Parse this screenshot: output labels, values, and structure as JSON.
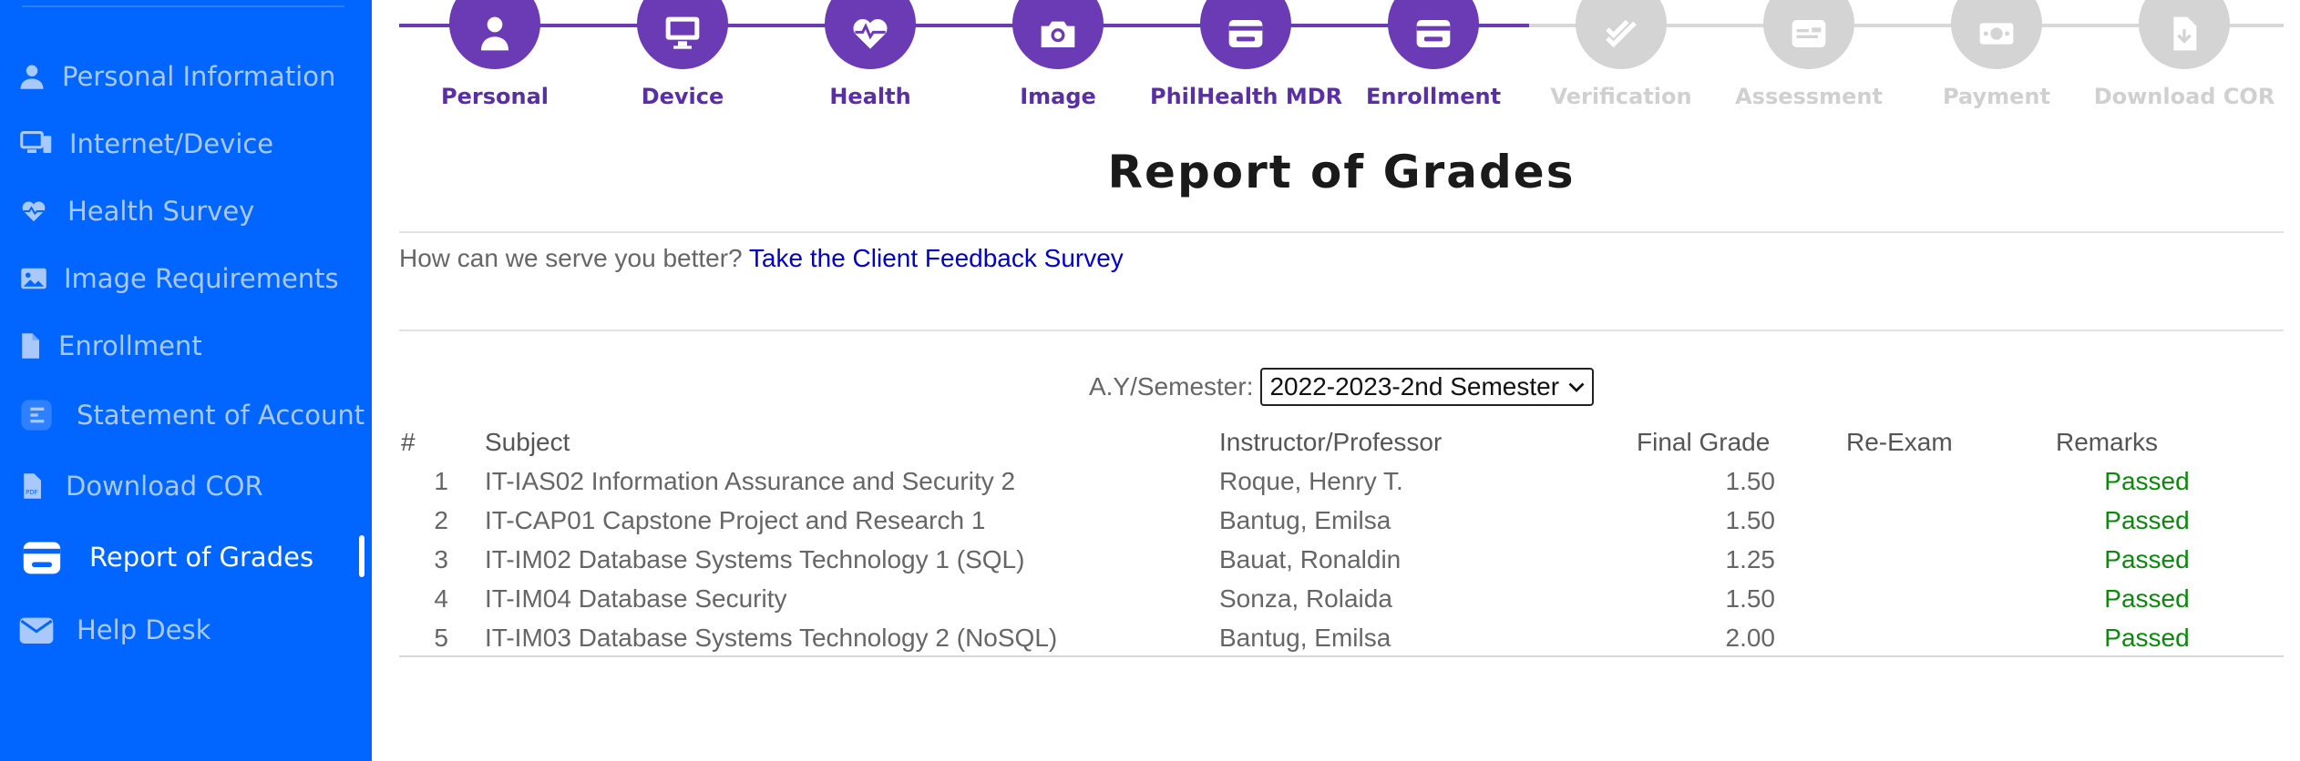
{
  "sidebar": {
    "items": [
      {
        "label": "Personal Information",
        "icon": "person-icon"
      },
      {
        "label": "Internet/Device",
        "icon": "device-icon"
      },
      {
        "label": "Health Survey",
        "icon": "heart-icon"
      },
      {
        "label": "Image Requirements",
        "icon": "image-icon"
      },
      {
        "label": "Enrollment",
        "icon": "file-icon"
      },
      {
        "label": "Statement of Account",
        "icon": "list-icon"
      },
      {
        "label": "Download COR",
        "icon": "pdf-icon"
      },
      {
        "label": "Report of Grades",
        "icon": "wallet-icon"
      },
      {
        "label": "Help Desk",
        "icon": "envelope-icon"
      }
    ],
    "active_item": "Report of Grades"
  },
  "stepper": {
    "steps": [
      {
        "label": "Personal",
        "icon": "person-icon",
        "done": true
      },
      {
        "label": "Device",
        "icon": "monitor-icon",
        "done": true
      },
      {
        "label": "Health",
        "icon": "heartbeat-icon",
        "done": true
      },
      {
        "label": "Image",
        "icon": "camera-icon",
        "done": true
      },
      {
        "label": "PhilHealth MDR",
        "icon": "card-icon",
        "done": true
      },
      {
        "label": "Enrollment",
        "icon": "card-icon",
        "done": true
      },
      {
        "label": "Verification",
        "icon": "check-double-icon",
        "done": false
      },
      {
        "label": "Assessment",
        "icon": "id-card-icon",
        "done": false
      },
      {
        "label": "Payment",
        "icon": "money-icon",
        "done": false
      },
      {
        "label": "Download COR",
        "icon": "file-download-icon",
        "done": false
      }
    ],
    "colors": {
      "done": "#6a3bb5",
      "pending": "#d4d4d4",
      "done_label": "#5a2ea6",
      "pending_label": "#d0d0d0"
    }
  },
  "page": {
    "title": "Report of Grades",
    "survey_prompt": "How can we serve you better?",
    "survey_link": "Take the Client Feedback Survey",
    "semester_label": "A.Y/Semester:",
    "semester_value": "2022-2023-2nd Semester"
  },
  "table": {
    "headers": {
      "num": "#",
      "subject": "Subject",
      "instructor": "Instructor/Professor",
      "grade": "Final Grade",
      "reexam": "Re-Exam",
      "remarks": "Remarks"
    },
    "rows": [
      {
        "num": "1",
        "subject": "IT-IAS02 Information Assurance and Security 2",
        "instructor": "Roque, Henry T.",
        "grade": "1.50",
        "reexam": "",
        "remarks": "Passed"
      },
      {
        "num": "2",
        "subject": "IT-CAP01 Capstone Project and Research 1",
        "instructor": "Bantug, Emilsa",
        "grade": "1.50",
        "reexam": "",
        "remarks": "Passed"
      },
      {
        "num": "3",
        "subject": "IT-IM02 Database Systems Technology 1 (SQL)",
        "instructor": "Bauat, Ronaldin",
        "grade": "1.25",
        "reexam": "",
        "remarks": "Passed"
      },
      {
        "num": "4",
        "subject": "IT-IM04 Database Security",
        "instructor": "Sonza, Rolaida",
        "grade": "1.50",
        "reexam": "",
        "remarks": "Passed"
      },
      {
        "num": "5",
        "subject": "IT-IM03 Database Systems Technology 2 (NoSQL)",
        "instructor": "Bantug, Emilsa",
        "grade": "2.00",
        "reexam": "",
        "remarks": "Passed"
      }
    ]
  }
}
